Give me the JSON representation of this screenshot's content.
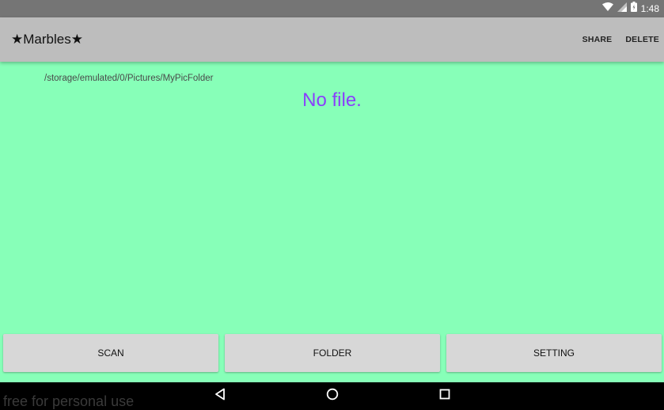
{
  "status_bar": {
    "time": "1:48",
    "icons": [
      "wifi-icon",
      "signal-icon",
      "battery-icon"
    ]
  },
  "app_bar": {
    "title": "★Marbles★",
    "actions": [
      "SHARE",
      "DELETE"
    ]
  },
  "content": {
    "path": "/storage/emulated/0/Pictures/MyPicFolder",
    "message": "No file."
  },
  "buttons": {
    "scan": "SCAN",
    "folder": "FOLDER",
    "setting": "SETTING"
  },
  "navigation": {
    "icons": [
      "back-icon",
      "home-icon",
      "recents-icon"
    ]
  },
  "watermark": "free for personal use",
  "colors": {
    "background": "#87ffb8",
    "app_bar": "#bdbdbd",
    "status_bar": "#757575",
    "message": "#8a3ffc",
    "button": "#d7d7d7"
  }
}
